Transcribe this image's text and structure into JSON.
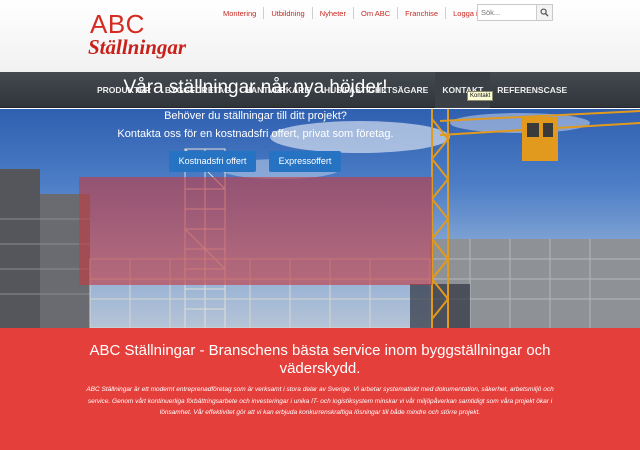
{
  "logo": {
    "line1": "ABC",
    "line2": "Ställningar"
  },
  "topnav": {
    "links": [
      "Montering",
      "Utbildning",
      "Nyheter",
      "Om ABC",
      "Franchise"
    ],
    "login": "Logga in"
  },
  "search": {
    "placeholder": "Sök...",
    "icon": "search-icon"
  },
  "mainnav": {
    "items": [
      "PRODUKTER",
      "BYGGFÖRETAG",
      "HANTVERKARE",
      "HUS/FASTIGHETSÄGARE",
      "KONTAKT",
      "REFERENSCASE"
    ],
    "active": "KONTAKT",
    "tooltip": "Kontakt"
  },
  "hero": {
    "title": "Våra ställningar når nya höjder!",
    "line1": "Behöver du ställningar till ditt projekt?",
    "line2": "Kontakta oss för en kostnadsfri offert, privat som företag.",
    "button1": "Kostnadsfri offert",
    "button2": "Expressoffert"
  },
  "intro": {
    "title": "ABC Ställningar - Branschens bästa service inom byggställningar och väderskydd.",
    "body": "ABC Ställningar är ett modernt entreprenadföretag som är verksamt i stora delar av Sverige. Vi arbetar systematiskt med dokumentation, säkerhet, arbetsmiljö och service. Genom vårt kontinuerliga förbättringsarbete och investeringar i unika IT- och logistiksystem minskar vi vår miljöpåverkan samtidigt som våra projekt ökar i lönsamhet. Vår effektivitet gör att vi kan erbjuda konkurrenskraftiga lösningar till både mindre och större projekt."
  },
  "colors": {
    "brand_red": "#d62b22",
    "nav_dark": "#3a4045",
    "button_blue": "#2673c3",
    "section_red": "#e53f3c"
  }
}
